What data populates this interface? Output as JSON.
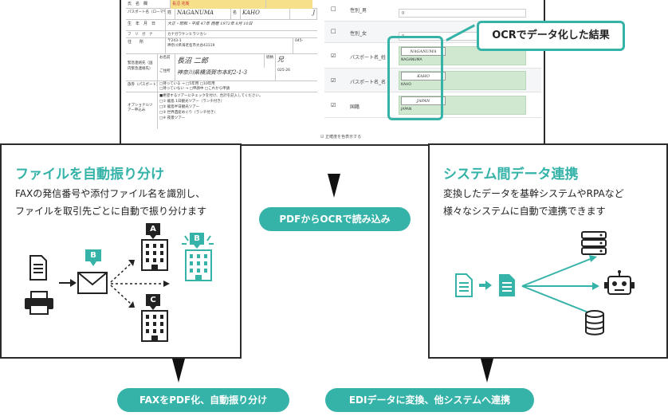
{
  "screenshot": {
    "form": {
      "row_name_label": "氏　名　欄",
      "row_name_value": "長沼 花衛",
      "row_passport_label": "パスポート名（ローマ字）",
      "sei_label": "姓",
      "sei_value": "NAGANUMA",
      "mei_label": "名",
      "mei_value": "KAHO",
      "sex_value": "J",
      "birth_label": "生　年　月　日",
      "birth_value": "大正・昭和・平成 47年 西暦 1972年 8月 10日",
      "furigana_label": "フ　リ　ガ　ナ",
      "furigana_value": "カナガワケンヒラツカシ",
      "address_label": "住　　所",
      "address_postcode": "〒243-1",
      "address_value": "神奈川県海老名市大谷43119",
      "phone_partial": "045-",
      "emergency_label": "緊急連絡先（国内緊急連絡先）",
      "emergency_name_label": "お名前",
      "emergency_name_value": "長沼 二郎",
      "relation_label": "続柄",
      "relation_value": "兄",
      "emergency_addr_label": "ご住所",
      "emergency_addr_value": "神奈川県横須賀市本町2-1-3",
      "other_label": "その他（ ）",
      "tel_label": "電話",
      "tel_value": "025-26",
      "passport_label": "旅券（パスポート）",
      "passport_opt1": "□持っている → □5年用 □10年用",
      "passport_opt2": "□持っていない → □申請中 □これから申請",
      "options_label": "オプショナルツアー申込み",
      "options_header": "■希望するツアーにチェックを付け、合計を記入してください。",
      "options_col": "金額",
      "tour1": "□① 龍島 1日観光ツアー（ランチ付き）",
      "tour2": "□② 龍島半日観光ツアー",
      "tour3": "□③ 世界遺産めぐり（ランチ付き）",
      "tour4": "□④ 夜景ツアー",
      "tour_amount": "00"
    },
    "status_text": "☑ 正確度を色表示する",
    "panel_rows": [
      {
        "check": "□",
        "name": "性別_男",
        "value": "0"
      },
      {
        "check": "□",
        "name": "性別_女",
        "value": "0"
      },
      {
        "check": "☑",
        "name": "パスポート名_姓",
        "image": "NAGANUMA",
        "value": "NAGANUMA"
      },
      {
        "check": "☑",
        "name": "パスポート名_名",
        "image": "KAHO",
        "value": "KAHO"
      },
      {
        "check": "☑",
        "name": "国籍",
        "image": "JAPAN",
        "value": "JAPAN"
      }
    ],
    "callout": "OCRでデータ化した結果"
  },
  "left_card": {
    "title": "ファイルを自動振り分け",
    "desc_line1": "FAXの発信番号や添付ファイル名を識別し、",
    "desc_line2": "ファイルを取引先ごとに自動で振り分けます",
    "badge_a": "A",
    "badge_b": "B",
    "badge_c": "C",
    "mail_badge": "B"
  },
  "right_card": {
    "title": "システム間データ連携",
    "desc_line1": "変換したデータを基幹システムやRPAなど",
    "desc_line2": "様々なシステムに自動で連携できます"
  },
  "pills": {
    "center": "PDFからOCRで読み込み",
    "left": "FAXをPDF化、自動振り分け",
    "right": "EDIデータに変換、他システムへ連携"
  },
  "colors": {
    "accent": "#35b3a8",
    "dark": "#2b2b2b"
  }
}
